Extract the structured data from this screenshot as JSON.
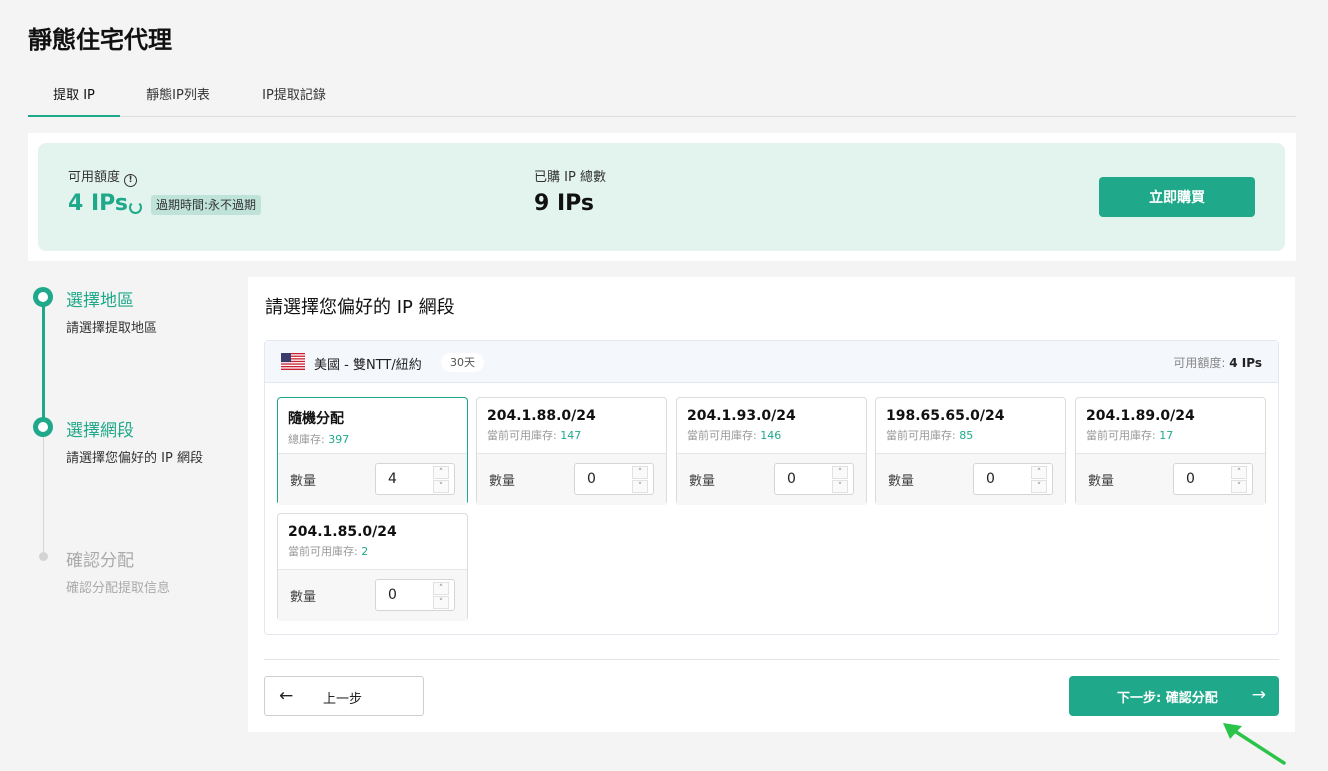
{
  "page_title": "靜態住宅代理",
  "tabs": [
    {
      "label": "提取 IP",
      "active": true
    },
    {
      "label": "靜態IP列表",
      "active": false
    },
    {
      "label": "IP提取記錄",
      "active": false
    }
  ],
  "quota": {
    "available_label": "可用額度",
    "available_value": "4 IPs",
    "expire_tag": "過期時間:永不過期",
    "purchased_label": "已購 IP 總數",
    "purchased_value": "9 IPs",
    "buy_button": "立即購買"
  },
  "steps": [
    {
      "title": "選擇地區",
      "subtitle": "請選擇提取地區",
      "state": "done"
    },
    {
      "title": "選擇網段",
      "subtitle": "請選擇您偏好的 IP 網段",
      "state": "active"
    },
    {
      "title": "確認分配",
      "subtitle": "確認分配提取信息",
      "state": "pending"
    }
  ],
  "panel": {
    "title": "請選擇您偏好的 IP 網段",
    "region": {
      "flag_icon": "us-flag-icon",
      "name": "美國 - 雙NTT/紐約",
      "days": "30天",
      "quota_label": "可用額度:",
      "quota_value": "4 IPs"
    },
    "qty_label": "數量",
    "cards": [
      {
        "name": "隨機分配",
        "stock_label": "總庫存:",
        "stock": "397",
        "qty": "4",
        "selected": true
      },
      {
        "name": "204.1.88.0/24",
        "stock_label": "當前可用庫存:",
        "stock": "147",
        "qty": "0",
        "selected": false
      },
      {
        "name": "204.1.93.0/24",
        "stock_label": "當前可用庫存:",
        "stock": "146",
        "qty": "0",
        "selected": false
      },
      {
        "name": "198.65.65.0/24",
        "stock_label": "當前可用庫存:",
        "stock": "85",
        "qty": "0",
        "selected": false
      },
      {
        "name": "204.1.89.0/24",
        "stock_label": "當前可用庫存:",
        "stock": "17",
        "qty": "0",
        "selected": false
      },
      {
        "name": "204.1.85.0/24",
        "stock_label": "當前可用庫存:",
        "stock": "2",
        "qty": "0",
        "selected": false
      }
    ],
    "prev_button": "上一步",
    "next_button": "下一步: 確認分配"
  },
  "colors": {
    "accent": "#1fa98a",
    "quota_bg": "#e3f4ef"
  }
}
